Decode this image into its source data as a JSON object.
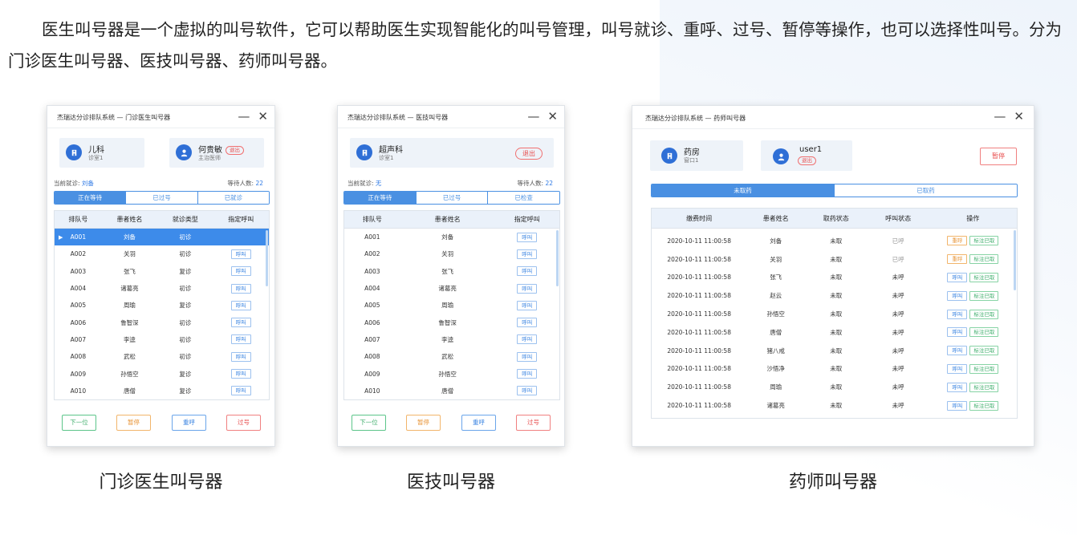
{
  "intro_text": "医生叫号器是一个虚拟的叫号软件，它可以帮助医生实现智能化的叫号管理，叫号就诊、重呼、过号、暂停等操作，也可以选择性叫号。分为门诊医生叫号器、医技叫号器、药师叫号器。",
  "captions": {
    "outpatient": "门诊医生叫号器",
    "medtech": "医技叫号器",
    "pharmacy": "药师叫号器"
  },
  "window_controls": {
    "minimize": "—",
    "close": "✕"
  },
  "colors": {
    "primary": "#4a90e2",
    "accent_red": "#e85050",
    "accent_green": "#3fae6c",
    "accent_orange": "#e8963a"
  },
  "outpatient": {
    "title": "杰瑞达分诊排队系统 — 门诊医生叫号器",
    "dept_name": "儿科",
    "dept_room": "诊室1",
    "doctor_name": "何贵敏",
    "doctor_title": "主治医师",
    "logout": "退出",
    "current_label": "当前就诊:",
    "current_value": "刘备",
    "waiting_label": "等待人数:",
    "waiting_value": "22",
    "tabs": [
      "正在等待",
      "已过号",
      "已就诊"
    ],
    "columns": [
      "排队号",
      "患者姓名",
      "就诊类型",
      "指定呼叫"
    ],
    "call_label": "呼叫",
    "rows": [
      {
        "no": "A001",
        "name": "刘备",
        "type": "初诊"
      },
      {
        "no": "A002",
        "name": "关羽",
        "type": "初诊"
      },
      {
        "no": "A003",
        "name": "张飞",
        "type": "复诊"
      },
      {
        "no": "A004",
        "name": "诸葛亮",
        "type": "初诊"
      },
      {
        "no": "A005",
        "name": "周瑜",
        "type": "复诊"
      },
      {
        "no": "A006",
        "name": "鲁智深",
        "type": "初诊"
      },
      {
        "no": "A007",
        "name": "李逵",
        "type": "初诊"
      },
      {
        "no": "A008",
        "name": "武松",
        "type": "初诊"
      },
      {
        "no": "A009",
        "name": "孙悟空",
        "type": "复诊"
      },
      {
        "no": "A010",
        "name": "唐僧",
        "type": "复诊"
      }
    ],
    "buttons": {
      "next": "下一位",
      "pause": "暂停",
      "recall": "重呼",
      "skip": "过号"
    }
  },
  "medtech": {
    "title": "杰瑞达分诊排队系统 — 医技叫号器",
    "dept_name": "超声科",
    "dept_room": "诊室1",
    "logout": "退出",
    "current_label": "当前就诊:",
    "current_value": "无",
    "waiting_label": "等待人数:",
    "waiting_value": "22",
    "tabs": [
      "正在等待",
      "已过号",
      "已检查"
    ],
    "columns": [
      "排队号",
      "患者姓名",
      "指定呼叫"
    ],
    "call_label": "呼叫",
    "rows": [
      {
        "no": "A001",
        "name": "刘备"
      },
      {
        "no": "A002",
        "name": "关羽"
      },
      {
        "no": "A003",
        "name": "张飞"
      },
      {
        "no": "A004",
        "name": "诸葛亮"
      },
      {
        "no": "A005",
        "name": "周瑜"
      },
      {
        "no": "A006",
        "name": "鲁智深"
      },
      {
        "no": "A007",
        "name": "李逵"
      },
      {
        "no": "A008",
        "name": "武松"
      },
      {
        "no": "A009",
        "name": "孙悟空"
      },
      {
        "no": "A010",
        "name": "唐僧"
      }
    ],
    "buttons": {
      "next": "下一位",
      "pause": "暂停",
      "recall": "重呼",
      "skip": "过号"
    }
  },
  "pharmacy": {
    "title": "杰瑞达分诊排队系统 — 药师叫号器",
    "dept_name": "药房",
    "dept_window": "窗口1",
    "user_name": "user1",
    "logout": "退出",
    "pause": "暂停",
    "tabs": [
      "未取药",
      "已取药"
    ],
    "columns": [
      "缴费时间",
      "患者姓名",
      "取药状态",
      "呼叫状态",
      "操作"
    ],
    "call_label": "呼叫",
    "recall_label": "重呼",
    "mark_label": "标注已取",
    "rows": [
      {
        "time": "2020-10-11  11:00:58",
        "name": "刘备",
        "take": "未取",
        "call": "已呼"
      },
      {
        "time": "2020-10-11  11:00:58",
        "name": "关羽",
        "take": "未取",
        "call": "已呼"
      },
      {
        "time": "2020-10-11  11:00:58",
        "name": "张飞",
        "take": "未取",
        "call": "未呼"
      },
      {
        "time": "2020-10-11  11:00:58",
        "name": "赵云",
        "take": "未取",
        "call": "未呼"
      },
      {
        "time": "2020-10-11  11:00:58",
        "name": "孙悟空",
        "take": "未取",
        "call": "未呼"
      },
      {
        "time": "2020-10-11  11:00:58",
        "name": "唐僧",
        "take": "未取",
        "call": "未呼"
      },
      {
        "time": "2020-10-11  11:00:58",
        "name": "猪八戒",
        "take": "未取",
        "call": "未呼"
      },
      {
        "time": "2020-10-11  11:00:58",
        "name": "沙悟净",
        "take": "未取",
        "call": "未呼"
      },
      {
        "time": "2020-10-11  11:00:58",
        "name": "周瑜",
        "take": "未取",
        "call": "未呼"
      },
      {
        "time": "2020-10-11  11:00:58",
        "name": "诸葛亮",
        "take": "未取",
        "call": "未呼"
      }
    ]
  }
}
